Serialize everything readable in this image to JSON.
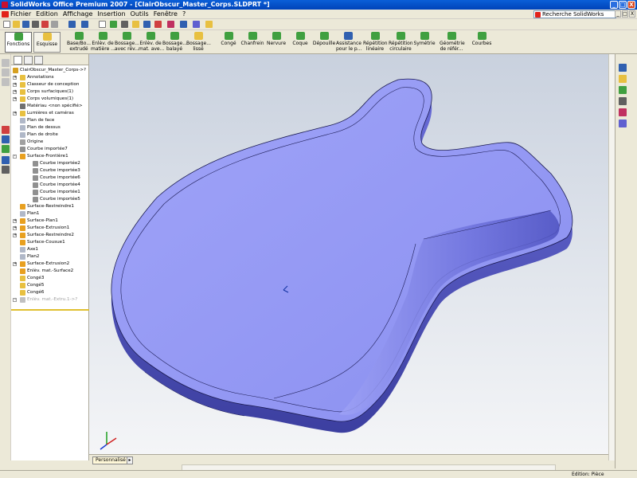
{
  "window": {
    "title": "SolidWorks Office Premium 2007 - [ClairObscur_Master_Corps.SLDPRT *]",
    "min_glyph": "_",
    "max_glyph": "□",
    "close_glyph": "X"
  },
  "menubar": {
    "items": [
      "Fichier",
      "Edition",
      "Affichage",
      "Insertion",
      "Outils",
      "Fenêtre",
      "?"
    ],
    "search_placeholder": "Recherche SolidWorks"
  },
  "commandmanager": {
    "switch_buttons": [
      {
        "label": "Fonctions",
        "active": true
      },
      {
        "label": "Esquisse",
        "active": false
      }
    ],
    "tools": [
      "Base/Bo...\nextrudé",
      "Enlèv. de\nmatière ...",
      "Bossage...\navec rév...",
      "Enlèv. de\nmat. ave...",
      "Bossage...\nbalayé",
      "Bossage...\nlissé",
      "Congé",
      "Chanfrein",
      "Nervure",
      "Coque",
      "Dépouille",
      "Assistance\npour le p...",
      "Répétition\nlinéaire",
      "Répétition\ncirculaire",
      "Symétrie",
      "Géométrie\nde référ...",
      "Courbes"
    ]
  },
  "feature_tree": {
    "root": "ClairObscur_Master_Corps->?",
    "items": [
      {
        "label": "Annotations",
        "icon": "annotations-icon",
        "level": 1,
        "expander": "+"
      },
      {
        "label": "Classeur de conception",
        "icon": "design-binder-icon",
        "level": 1,
        "expander": "+"
      },
      {
        "label": "Corps surfaciques(1)",
        "icon": "surface-bodies-icon",
        "level": 1,
        "expander": "+"
      },
      {
        "label": "Corps volumiques(1)",
        "icon": "solid-bodies-icon",
        "level": 1,
        "expander": "+"
      },
      {
        "label": "Matériau <non spécifié>",
        "icon": "material-icon",
        "level": 1,
        "expander": ""
      },
      {
        "label": "Lumières et caméras",
        "icon": "lights-icon",
        "level": 1,
        "expander": "+"
      },
      {
        "label": "Plan de face",
        "icon": "plane-icon",
        "level": 1,
        "expander": ""
      },
      {
        "label": "Plan de dessus",
        "icon": "plane-icon",
        "level": 1,
        "expander": ""
      },
      {
        "label": "Plan de droite",
        "icon": "plane-icon",
        "level": 1,
        "expander": ""
      },
      {
        "label": "Origine",
        "icon": "origin-icon",
        "level": 1,
        "expander": ""
      },
      {
        "label": "Courbe importée7",
        "icon": "curve-icon",
        "level": 1,
        "expander": ""
      },
      {
        "label": "Surface-Frontière1",
        "icon": "boundary-surface-icon",
        "level": 1,
        "expander": "-"
      },
      {
        "label": "Courbe importée2",
        "icon": "curve-icon",
        "level": 2,
        "expander": ""
      },
      {
        "label": "Courbe importée3",
        "icon": "curve-icon",
        "level": 2,
        "expander": ""
      },
      {
        "label": "Courbe importée6",
        "icon": "curve-icon",
        "level": 2,
        "expander": ""
      },
      {
        "label": "Courbe importée4",
        "icon": "curve-icon",
        "level": 2,
        "expander": ""
      },
      {
        "label": "Courbe importée1",
        "icon": "curve-icon",
        "level": 2,
        "expander": ""
      },
      {
        "label": "Courbe importée5",
        "icon": "curve-icon",
        "level": 2,
        "expander": ""
      },
      {
        "label": "Surface-Restreindre1",
        "icon": "trim-surface-icon",
        "level": 1,
        "expander": ""
      },
      {
        "label": "Plan1",
        "icon": "plane-icon",
        "level": 1,
        "expander": ""
      },
      {
        "label": "Surface-Plan1",
        "icon": "planar-surface-icon",
        "level": 1,
        "expander": "+"
      },
      {
        "label": "Surface-Extrusion1",
        "icon": "extrude-surface-icon",
        "level": 1,
        "expander": "+"
      },
      {
        "label": "Surface-Restreindre2",
        "icon": "trim-surface-icon",
        "level": 1,
        "expander": "+"
      },
      {
        "label": "Surface-Cousue1",
        "icon": "knit-surface-icon",
        "level": 1,
        "expander": ""
      },
      {
        "label": "Axe1",
        "icon": "axis-icon",
        "level": 1,
        "expander": ""
      },
      {
        "label": "Plan2",
        "icon": "plane-icon",
        "level": 1,
        "expander": ""
      },
      {
        "label": "Surface-Extrusion2",
        "icon": "extrude-surface-icon",
        "level": 1,
        "expander": "+"
      },
      {
        "label": "Enlèv. mat.-Surface2",
        "icon": "cut-surface-icon",
        "level": 1,
        "expander": ""
      },
      {
        "label": "Congé3",
        "icon": "fillet-icon",
        "level": 1,
        "expander": ""
      },
      {
        "label": "Congé5",
        "icon": "fillet-icon",
        "level": 1,
        "expander": ""
      },
      {
        "label": "Congé6",
        "icon": "fillet-icon",
        "level": 1,
        "expander": ""
      },
      {
        "label": "Enlèv. mat.-Extru.1->?",
        "icon": "cut-extrude-icon",
        "level": 1,
        "expander": "+",
        "suppressed": true
      }
    ]
  },
  "view_tabs": {
    "active": "Personnalisé",
    "arrow_glyph": "▸"
  },
  "statusbar": {
    "text": "Edition: Pièce"
  },
  "colors": {
    "part_top": "#8a8ff0",
    "part_side": "#4c4fb8",
    "title_bar": "#0a5fd8"
  }
}
